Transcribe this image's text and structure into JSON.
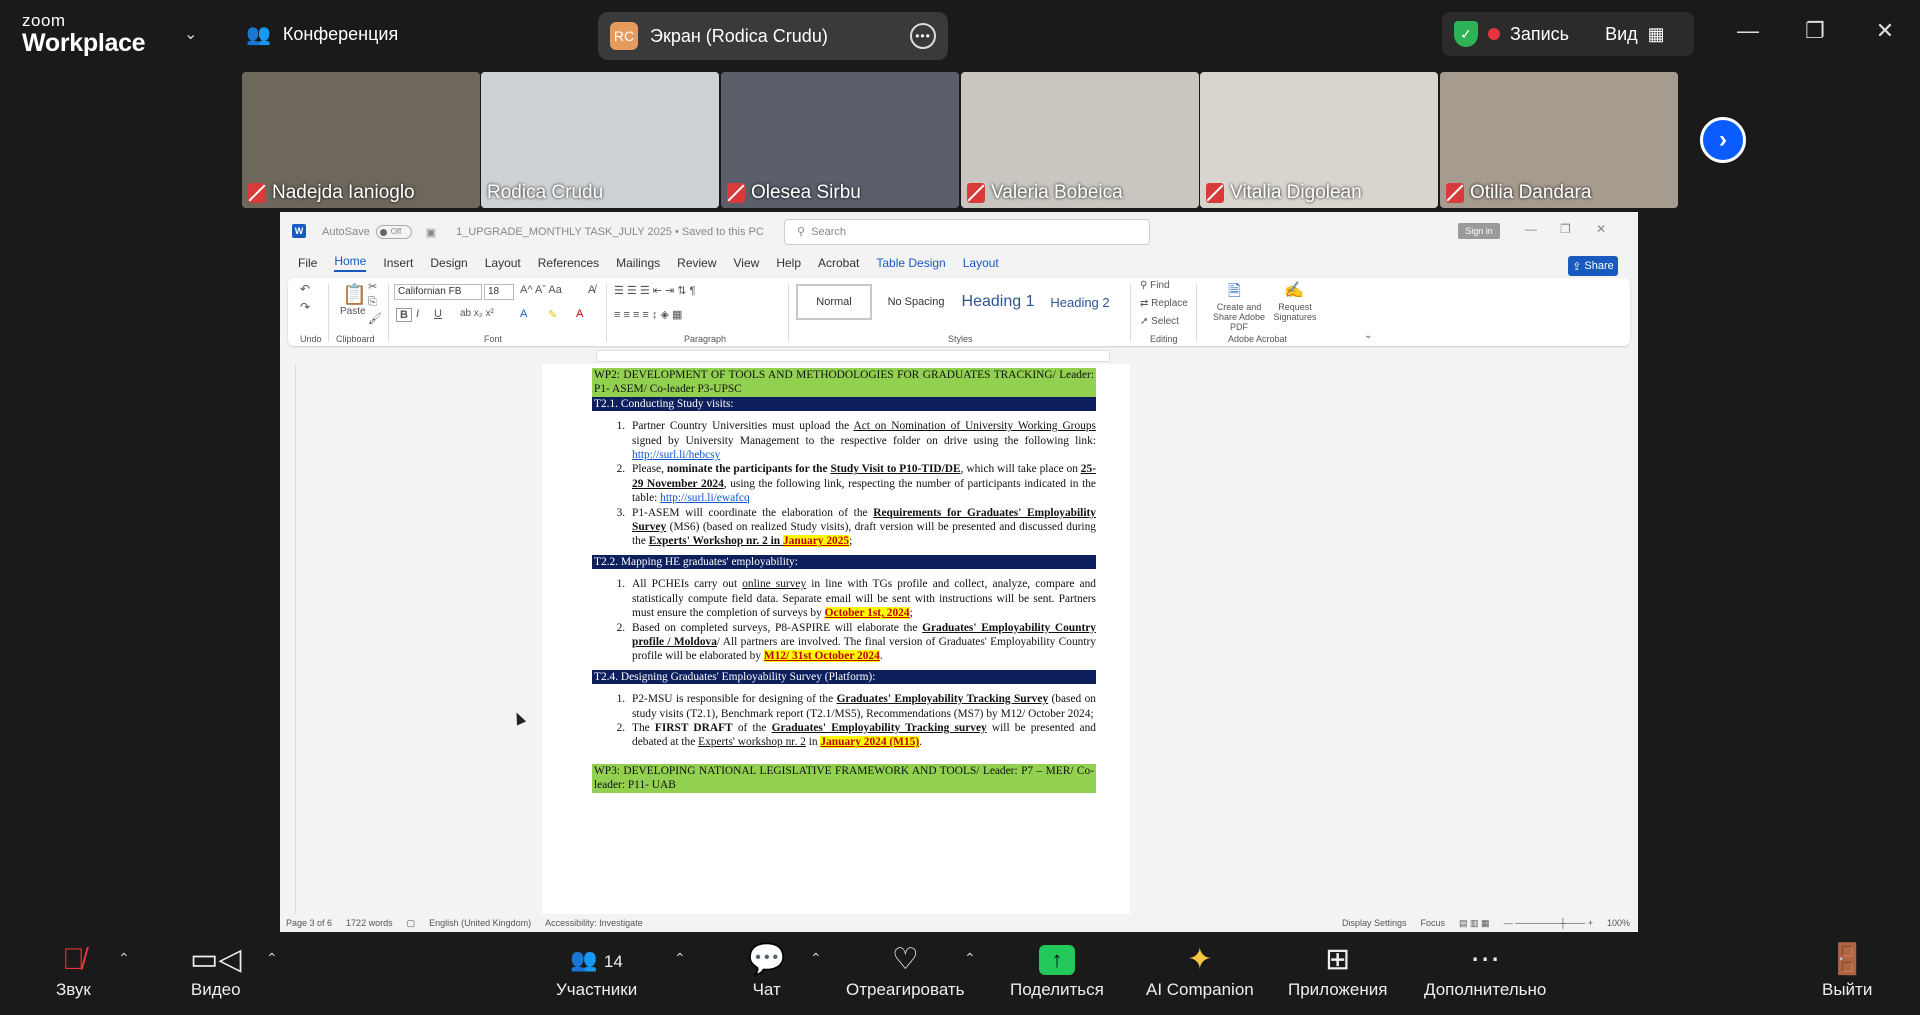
{
  "app": {
    "brand_line1": "zoom",
    "brand_line2": "Workplace"
  },
  "topbar": {
    "meeting_label": "Конференция",
    "share_initials": "RC",
    "share_label": "Экран (Rodica Crudu)",
    "record_label": "Запись",
    "view_label": "Вид"
  },
  "participants": [
    {
      "name": "Nadejda Ianioglo",
      "muted": true,
      "bg": "#6e675c"
    },
    {
      "name": "Rodica Crudu",
      "muted": false,
      "bg": "#cfd2d4"
    },
    {
      "name": "Olesea Sirbu",
      "muted": true,
      "bg": "#5a5f6a"
    },
    {
      "name": "Valeria Bobeica",
      "muted": true,
      "bg": "#c9c6c0"
    },
    {
      "name": "Vitalia Digolean",
      "muted": true,
      "bg": "#d8d4ce"
    },
    {
      "name": "Otilia Dandara",
      "muted": true,
      "bg": "#a59b8e"
    }
  ],
  "word": {
    "autosave": "AutoSave",
    "toggle": "Off",
    "filename": "1_UPGRADE_MONTHLY TASK_JULY 2025 • Saved to this PC",
    "search_placeholder": "Search",
    "signin": "Sign in",
    "menu": [
      "File",
      "Home",
      "Insert",
      "Design",
      "Layout",
      "References",
      "Mailings",
      "Review",
      "View",
      "Help",
      "Acrobat",
      "Table Design",
      "Layout"
    ],
    "share": "Share",
    "ribbon": {
      "undo": "Undo",
      "clipboard": "Clipboard",
      "paste": "Paste",
      "font_group": "Font",
      "font_name": "Californian FB",
      "font_size": "18",
      "paragraph": "Paragraph",
      "styles_group": "Styles",
      "styles": [
        "Normal",
        "No Spacing",
        "Heading 1",
        "Heading 2"
      ],
      "editing": "Editing",
      "find": "Find",
      "replace": "Replace",
      "select": "Select",
      "create_share": "Create and Share Adobe PDF",
      "request_sig": "Request Signatures",
      "adobe": "Adobe Acrobat"
    },
    "status": {
      "page": "Page 3 of 6",
      "words": "1722 words",
      "lang": "English (United Kingdom)",
      "access": "Accessibility: Investigate",
      "display": "Display Settings",
      "focus": "Focus",
      "zoom": "100%"
    }
  },
  "doc": {
    "wp2": "WP2: DEVELOPMENT OF TOOLS AND METHODOLOGIES FOR GRADUATES TRACKING/ Leader: P1- ASEM/ Co-leader P3-UPSC",
    "t21": "T2.1. Conducting Study visits:",
    "t21_items": {
      "i1_a": "Partner Country Universities must upload the ",
      "i1_b": "Act on Nomination of University Working Groups",
      "i1_c": " signed by University Management to the respective folder on drive using the following link: ",
      "i1_link": "http://surl.li/hebcsy",
      "i2_a": "Please, ",
      "i2_b": "nominate the participants for the ",
      "i2_c": "Study Visit to P10-TID/DE",
      "i2_d": ", which will take place on ",
      "i2_e": "25-29 November 2024",
      "i2_f": ", using the following link, respecting the number of participants indicated in the table: ",
      "i2_link": "http://surl.li/ewafcq",
      "i3_a": "P1-ASEM will coordinate the elaboration of the ",
      "i3_b": "Requirements for Graduates' Employability Survey",
      "i3_c": " (MS6) (based on realized Study visits), draft version will be presented and discussed during the ",
      "i3_d": "Experts' Workshop nr. 2 in ",
      "i3_e": "January 2025",
      "i3_f": ";"
    },
    "t22": "T2.2. Mapping HE graduates' employability:",
    "t22_items": {
      "i1_a": "All PCHEIs carry out ",
      "i1_b": "online survey",
      "i1_c": " in line with TGs profile and collect, analyze, compare and statistically compute field data. Separate email will be sent with instructions will be sent. Partners must ensure the completion of surveys by ",
      "i1_d": "October 1st, 2024",
      "i1_e": ";",
      "i2_a": "Based on completed surveys, P8-ASPIRE will elaborate the ",
      "i2_b": "Graduates' Employability Country profile / Moldova",
      "i2_c": "/ All partners are involved. The final version of Graduates' Employability Country profile will be elaborated by ",
      "i2_d": "M12/ 31st October 2024",
      "i2_e": "."
    },
    "t24": "T2.4. Designing Graduates' Employability Survey (Platform):",
    "t24_items": {
      "i1_a": "P2-MSU is responsible for designing of the ",
      "i1_b": "Graduates' Employability Tracking Survey",
      "i1_c": " (based on study visits (T2.1), Benchmark report (T2.1/MS5), Recommendations (MS7) by M12/ October 2024;",
      "i2_a": "The ",
      "i2_b": "FIRST DRAFT",
      "i2_c": " of the ",
      "i2_d": "Graduates' Employability Tracking survey",
      "i2_e": " will be presented and debated at the ",
      "i2_f": "Experts' workshop nr. 2",
      "i2_g": " in ",
      "i2_h": "January 2024 (M15)",
      "i2_i": "."
    },
    "wp3": "WP3: DEVELOPING NATIONAL LEGISLATIVE FRAMEWORK AND TOOLS/ Leader: P7 – MER/ Co-leader: P11- UAB"
  },
  "bottombar": {
    "audio": "Звук",
    "video": "Видео",
    "participants": "Участники",
    "participants_count": "14",
    "chat": "Чат",
    "react": "Отреагировать",
    "share": "Поделиться",
    "ai": "AI Companion",
    "apps": "Приложения",
    "more": "Дополнительно",
    "leave": "Выйти"
  }
}
